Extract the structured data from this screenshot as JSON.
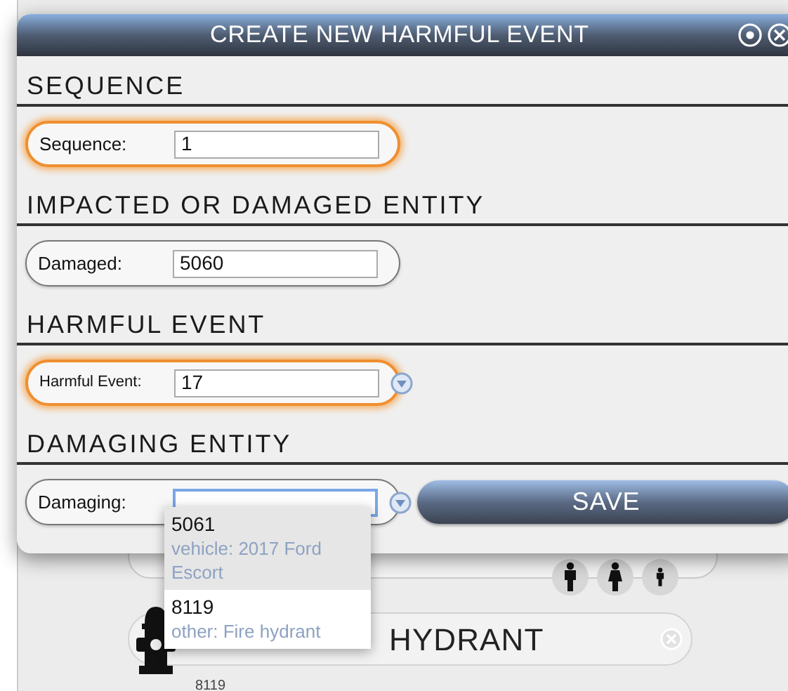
{
  "dialog": {
    "title": "CREATE NEW HARMFUL EVENT",
    "sections": [
      {
        "heading": "SEQUENCE",
        "field": {
          "kind": "text",
          "label": "Sequence:",
          "value": "1",
          "highlighted": true,
          "focused": false
        }
      },
      {
        "heading": "IMPACTED OR DAMAGED ENTITY",
        "field": {
          "kind": "text",
          "label": "Damaged:",
          "value": "5060",
          "highlighted": false,
          "focused": false
        }
      },
      {
        "heading": "HARMFUL EVENT",
        "field": {
          "kind": "combo",
          "label": "Harmful Event:",
          "value": "17",
          "highlighted": true,
          "focused": false
        }
      },
      {
        "heading": "DAMAGING ENTITY",
        "field": {
          "kind": "combo",
          "label": "Damaging:",
          "highlighted": false,
          "focused": true
        }
      }
    ],
    "save_button": "SAVE"
  },
  "suggestions": [
    {
      "id": "5061",
      "description": "vehicle: 2017 Ford Escort",
      "selected": true
    },
    {
      "id": "8119",
      "description": "other: Fire hydrant",
      "selected": false
    }
  ],
  "background": {
    "entity_name": "HYDRANT",
    "caption": "8119"
  }
}
